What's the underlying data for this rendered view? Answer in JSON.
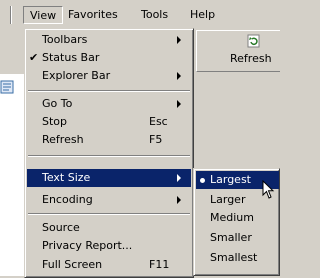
{
  "menubar": {
    "items": [
      {
        "label": "View"
      },
      {
        "label": "Favorites"
      },
      {
        "label": "Tools"
      },
      {
        "label": "Help"
      }
    ]
  },
  "toolbar": {
    "refresh_label": "Refresh",
    "refresh_icon": "refresh-icon"
  },
  "view_menu": {
    "toolbars": "Toolbars",
    "status_bar": "Status Bar",
    "status_bar_check": "✔",
    "explorer_bar": "Explorer Bar",
    "go_to": "Go To",
    "stop": "Stop",
    "stop_shortcut": "Esc",
    "refresh": "Refresh",
    "refresh_shortcut": "F5",
    "text_size": "Text Size",
    "encoding": "Encoding",
    "source": "Source",
    "privacy_report": "Privacy Report...",
    "full_screen": "Full Screen",
    "full_screen_shortcut": "F11"
  },
  "text_size_menu": {
    "items": [
      {
        "label": "Largest",
        "selected": true
      },
      {
        "label": "Larger"
      },
      {
        "label": "Medium"
      },
      {
        "label": "Smaller"
      },
      {
        "label": "Smallest"
      }
    ]
  },
  "colors": {
    "face": "#d4d0c8",
    "highlight": "#0a246a",
    "shadow": "#808080"
  }
}
